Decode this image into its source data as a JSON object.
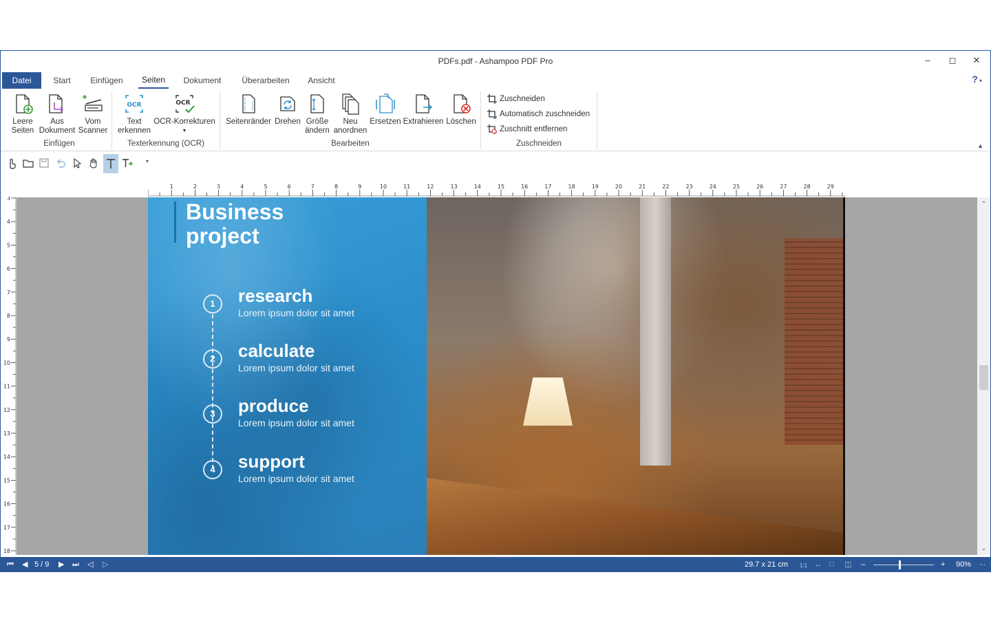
{
  "window": {
    "title": "PDFs.pdf - Ashampoo PDF Pro"
  },
  "tabs": [
    "Datei",
    "Start",
    "Einfügen",
    "Seiten",
    "Dokument",
    "Überarbeiten",
    "Ansicht"
  ],
  "help": "?",
  "ribbon": {
    "einfuegen": {
      "label": "Einfügen",
      "btn1": [
        "Leere",
        "Seiten"
      ],
      "btn2": [
        "Aus",
        "Dokument"
      ],
      "btn3": [
        "Vom",
        "Scanner"
      ]
    },
    "ocr": {
      "label": "Texterkennung (OCR)",
      "btn1": [
        "Text",
        "erkennen"
      ],
      "btn2": "OCR-Korrekturen"
    },
    "bearbeiten": {
      "label": "Bearbeiten",
      "seitenraender": "Seitenränder",
      "drehen": "Drehen",
      "groesse": [
        "Größe",
        "ändern"
      ],
      "neu": [
        "Neu",
        "anordnen"
      ],
      "ersetzen": "Ersetzen",
      "extrahieren": "Extrahieren",
      "loeschen": "Löschen"
    },
    "zuschneiden": {
      "label": "Zuschneiden",
      "item1": "Zuschneiden",
      "item2": "Automatisch zuschneiden",
      "item3": "Zuschnitt entfernen"
    }
  },
  "ruler": {
    "h": [
      "1",
      "2",
      "3",
      "4",
      "5",
      "6",
      "7",
      "8",
      "9",
      "10",
      "11",
      "12",
      "13",
      "14",
      "15",
      "16",
      "17",
      "18",
      "19",
      "20",
      "21",
      "22",
      "23",
      "24",
      "25",
      "26",
      "27",
      "28",
      "29"
    ],
    "v": [
      "3",
      "4",
      "5",
      "6",
      "7",
      "8",
      "9",
      "10",
      "11",
      "12",
      "13",
      "14",
      "15",
      "16",
      "17",
      "18"
    ]
  },
  "page": {
    "title_line1": "Business",
    "title_line2": "project",
    "steps": [
      {
        "num": "1",
        "title": "research",
        "sub": "Lorem ipsum dolor sit amet"
      },
      {
        "num": "2",
        "title": "calculate",
        "sub": "Lorem ipsum dolor sit amet"
      },
      {
        "num": "3",
        "title": "produce",
        "sub": "Lorem ipsum dolor sit amet"
      },
      {
        "num": "4",
        "title": "support",
        "sub": "Lorem ipsum dolor sit amet"
      }
    ]
  },
  "status": {
    "page": "5 / 9",
    "size": "29.7 x 21 cm",
    "ratio": "1:1",
    "zoom": "90%",
    "zoom_level": 0.42
  },
  "colors": {
    "accent": "#2b5797",
    "panel": "#2b8fcc"
  }
}
